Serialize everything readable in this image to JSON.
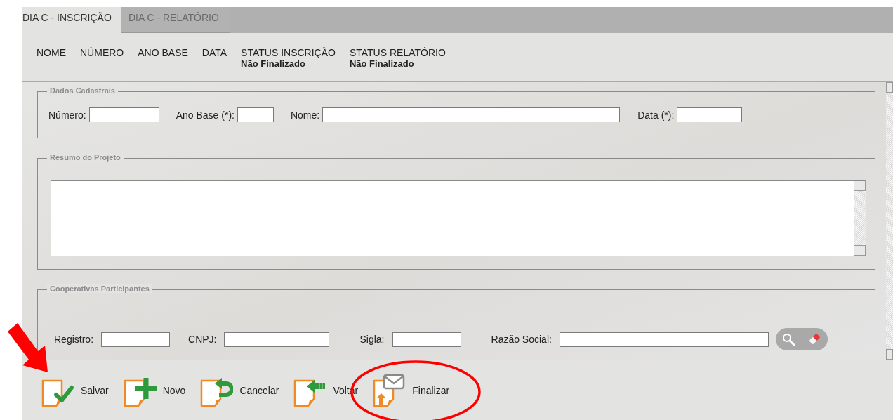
{
  "tabs": [
    {
      "label": "DIA C - INSCRIÇÃO",
      "selected": true
    },
    {
      "label": "DIA C - RELATÓRIO",
      "selected": false
    }
  ],
  "summary": [
    {
      "label": "NOME"
    },
    {
      "label": "NÚMERO"
    },
    {
      "label": "ANO BASE"
    },
    {
      "label": "DATA"
    },
    {
      "label": "STATUS INSCRIÇÃO",
      "value": "Não Finalizado"
    },
    {
      "label": "STATUS RELATÓRIO",
      "value": "Não Finalizado"
    }
  ],
  "sections": [
    {
      "kind": "fields",
      "legend": "Dados Cadastrais",
      "fields": [
        {
          "label": "Número:"
        },
        {
          "label": "Ano Base (*):"
        },
        {
          "label": "Nome:"
        },
        {
          "label": "Data (*):"
        }
      ]
    },
    {
      "kind": "textarea",
      "legend": "Resumo do Projeto"
    },
    {
      "kind": "fields",
      "legend": "Cooperativas Participantes",
      "fields": [
        {
          "label": "Registro:"
        },
        {
          "label": "CNPJ:"
        },
        {
          "label": "Sigla:"
        },
        {
          "label": "Razão Social:"
        }
      ],
      "lookup_buttons": [
        {
          "kind": "search"
        },
        {
          "kind": "clear"
        }
      ]
    }
  ],
  "toolbar": [
    {
      "label": "Salvar",
      "kind": "check"
    },
    {
      "label": "Novo",
      "kind": "plus"
    },
    {
      "label": "Cancelar",
      "kind": "undo"
    },
    {
      "label": "Voltar",
      "kind": "back"
    },
    {
      "label": "Finalizar",
      "kind": "send"
    }
  ],
  "annotations": [
    {
      "kind": "arrow"
    },
    {
      "kind": "ellipse"
    }
  ]
}
